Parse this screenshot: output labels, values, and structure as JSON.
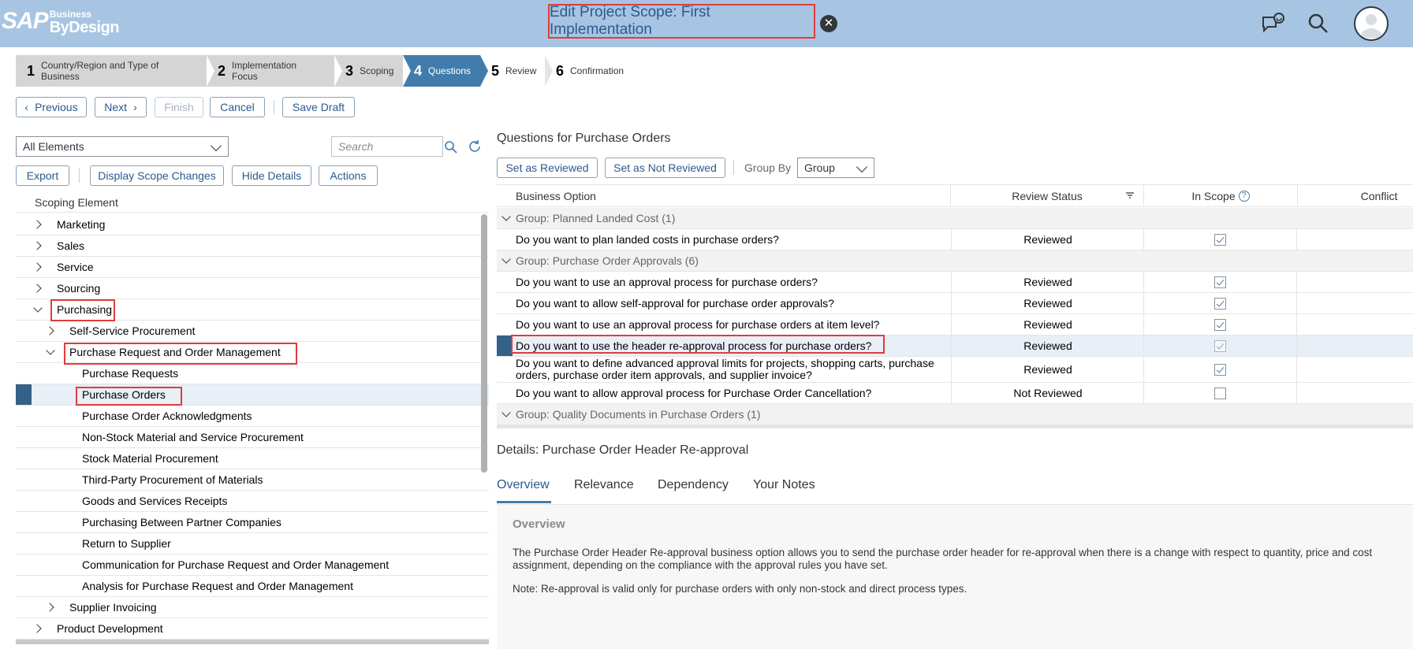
{
  "shell": {
    "logo": {
      "sap": "SAP",
      "business": "Business",
      "bydesign": "ByDesign"
    },
    "title": "Edit Project Scope: First Implementation"
  },
  "roadmap": [
    {
      "num": "1",
      "label": "Country/Region and Type of Business"
    },
    {
      "num": "2",
      "label": "Implementation Focus"
    },
    {
      "num": "3",
      "label": "Scoping"
    },
    {
      "num": "4",
      "label": "Questions"
    },
    {
      "num": "5",
      "label": "Review"
    },
    {
      "num": "6",
      "label": "Confirmation"
    }
  ],
  "toolbar": {
    "previous": "Previous",
    "next": "Next",
    "finish": "Finish",
    "cancel": "Cancel",
    "save_draft": "Save Draft"
  },
  "left": {
    "filter_value": "All Elements",
    "search_placeholder": "Search",
    "export": "Export",
    "display_scope_changes": "Display Scope Changes",
    "hide_details": "Hide Details",
    "actions": "Actions",
    "tree_header": "Scoping Element",
    "tree": [
      "Marketing",
      "Sales",
      "Service",
      "Sourcing",
      "Purchasing",
      "Self-Service Procurement",
      "Purchase Request and Order Management",
      "Purchase Requests",
      "Purchase Orders",
      "Purchase Order Acknowledgments",
      "Non-Stock Material and Service Procurement",
      "Stock Material Procurement",
      "Third-Party Procurement of Materials",
      "Goods and Services Receipts",
      "Purchasing Between Partner Companies",
      "Return to Supplier",
      "Communication for Purchase Request and Order Management",
      "Analysis for Purchase Request and Order Management",
      "Supplier Invoicing",
      "Product Development"
    ]
  },
  "questions": {
    "title": "Questions for Purchase Orders",
    "set_reviewed": "Set as Reviewed",
    "set_not_reviewed": "Set as Not Reviewed",
    "group_by_label": "Group By",
    "group_by_value": "Group",
    "columns": {
      "option": "Business Option",
      "status": "Review Status",
      "scope": "In Scope",
      "conflict": "Conflict"
    },
    "groups": [
      "Group: Planned Landed Cost (1)",
      "Group: Purchase Order Approvals (6)",
      "Group: Quality Documents in Purchase Orders (1)"
    ],
    "rows": [
      {
        "text": "Do you want to plan landed costs in purchase orders?",
        "status": "Reviewed",
        "in_scope": true
      },
      {
        "text": "Do you want to use an approval process for purchase orders?",
        "status": "Reviewed",
        "in_scope": true
      },
      {
        "text": "Do you want to allow self-approval for purchase order approvals?",
        "status": "Reviewed",
        "in_scope": true
      },
      {
        "text": "Do you want to use an approval process for purchase orders at item level?",
        "status": "Reviewed",
        "in_scope": true
      },
      {
        "text": "Do you want to use the header re-approval process for purchase orders?",
        "status": "Reviewed",
        "in_scope": true
      },
      {
        "text": "Do you want to define advanced approval limits for projects, shopping carts, purchase orders, purchase order item approvals, and supplier invoice?",
        "status": "Reviewed",
        "in_scope": true
      },
      {
        "text": "Do you want to allow approval process for Purchase Order Cancellation?",
        "status": "Not Reviewed",
        "in_scope": false
      }
    ]
  },
  "details": {
    "title": "Details: Purchase Order Header Re-approval",
    "tabs": [
      "Overview",
      "Relevance",
      "Dependency",
      "Your Notes"
    ],
    "overview_heading": "Overview",
    "paragraph1": "The Purchase Order Header Re-approval business option allows you to send the purchase order header for re-approval when there is a change with respect to quantity, price and cost assignment, depending on the compliance with the approval rules you have set.",
    "paragraph2": "Note: Re-approval is valid only for purchase orders with only non-stock and direct process types."
  }
}
